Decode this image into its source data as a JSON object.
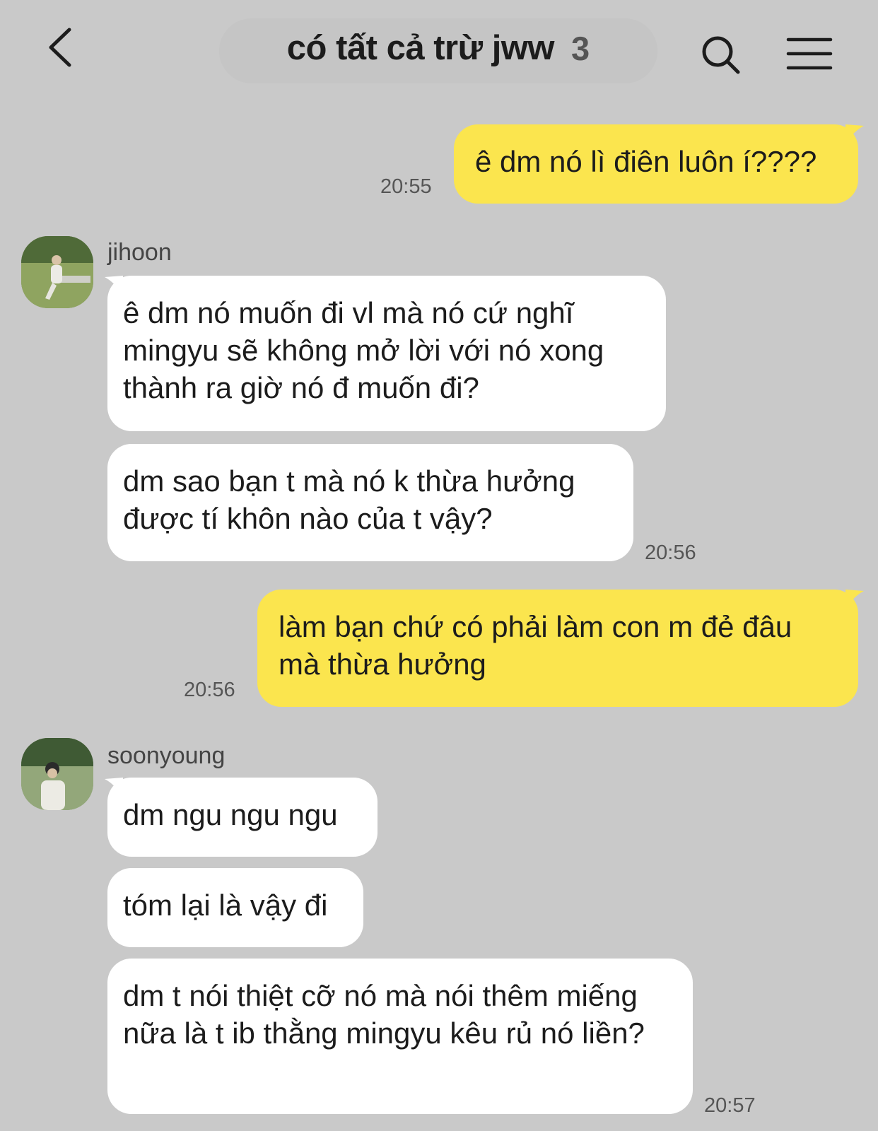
{
  "header": {
    "title": "có tất cả trừ jww",
    "member_count": "3"
  },
  "messages": [
    {
      "from": "me",
      "text": "ê dm nó lì điên luôn í????",
      "time": "20:55"
    },
    {
      "from": "jihoon",
      "text": "ê dm nó muốn đi vl mà nó cứ nghĩ mingyu sẽ không mở lời với nó xong thành ra giờ nó đ muốn đi?"
    },
    {
      "from": "jihoon",
      "text": "dm sao bạn t mà nó k thừa hưởng được tí khôn nào của t vậy?",
      "time": "20:56"
    },
    {
      "from": "me",
      "text": "làm bạn chứ có phải làm con m đẻ đâu mà thừa hưởng",
      "time": "20:56"
    },
    {
      "from": "soonyoung",
      "text": "dm ngu ngu ngu"
    },
    {
      "from": "soonyoung",
      "text": "tóm lại là vậy đi"
    },
    {
      "from": "soonyoung",
      "text": "dm t nói thiệt cỡ nó mà nói thêm miếng nữa là t ib thằng mingyu kêu rủ nó liền?",
      "time": "20:57"
    }
  ],
  "senders": {
    "jihoon": "jihoon",
    "soonyoung": "soonyoung"
  },
  "icons": {
    "back": "chevron-left-icon",
    "search": "search-icon",
    "menu": "hamburger-menu-icon"
  },
  "colors": {
    "background": "#c9c9c9",
    "my_bubble": "#fbe54e",
    "other_bubble": "#ffffff"
  }
}
